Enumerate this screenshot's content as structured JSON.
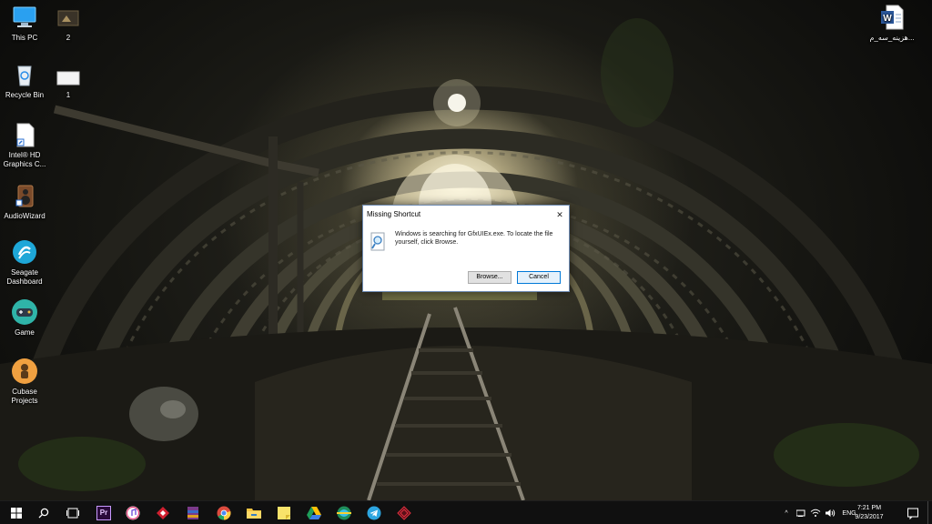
{
  "desktop": {
    "icons": [
      {
        "label": "This PC",
        "icon": "computer-icon"
      },
      {
        "label": "2",
        "icon": "folder-image-icon"
      },
      {
        "label": "Recycle Bin",
        "icon": "recycle-bin-icon"
      },
      {
        "label": "1",
        "icon": "file-icon"
      },
      {
        "label": "Intel® HD Graphics C...",
        "icon": "shortcut-file-icon"
      },
      {
        "label": "AudioWizard",
        "icon": "audio-wizard-icon"
      },
      {
        "label": "Seagate Dashboard",
        "icon": "seagate-icon"
      },
      {
        "label": "Game",
        "icon": "gamepad-icon"
      },
      {
        "label": "Cubase Projects",
        "icon": "cubase-icon"
      },
      {
        "label": "هزینه_سه_م...",
        "icon": "word-document-icon"
      }
    ]
  },
  "dialog": {
    "title": "Missing Shortcut",
    "close_symbol": "✕",
    "message": "Windows is searching for GfxUIEx.exe. To locate the file yourself, click Browse.",
    "browse_label": "Browse...",
    "cancel_label": "Cancel"
  },
  "taskbar": {
    "pinned": [
      "start-icon",
      "search-icon",
      "task-view-icon",
      "premiere-icon",
      "itunes-icon",
      "app-red-icon",
      "winrar-icon",
      "chrome-icon",
      "file-explorer-icon",
      "sticky-notes-icon",
      "google-drive-icon",
      "browser-globe-icon",
      "telegram-icon",
      "app-diamond-icon"
    ],
    "premiere_label": "Pr",
    "tray": {
      "chevron": "^",
      "language": "ENG",
      "time": "7:21 PM",
      "date": "9/23/2017"
    }
  },
  "colors": {
    "accent": "#0078d7",
    "taskbar": "#101010",
    "dialog_border": "#6e8bb3"
  }
}
